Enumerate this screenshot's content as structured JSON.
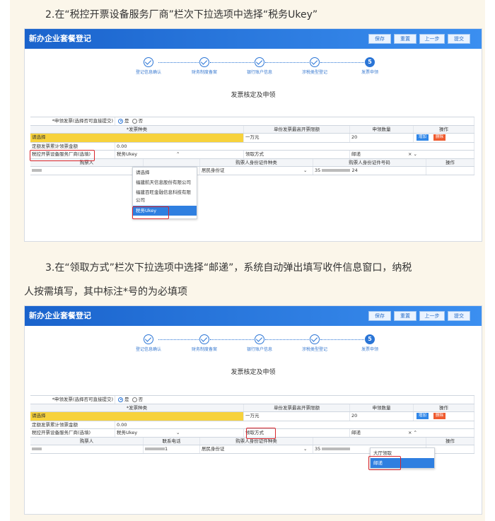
{
  "headings": {
    "step2": "2.在“税控开票设备服务厂商”栏次下拉选项中选择“税务Ukey”",
    "step3_line1": "3.在“领取方式”栏次下拉选项中选择“邮递”，系统自动弹出填写收件信息窗口，纳税",
    "step3_line2": "人按需填写，其中标注*号的为必填项"
  },
  "app": {
    "title": "新办企业套餐登记",
    "buttons": [
      "保存",
      "重置",
      "上一步",
      "提交"
    ]
  },
  "steps": [
    {
      "label": "登记信息确认",
      "state": "done"
    },
    {
      "label": "财务制度备案",
      "state": "done"
    },
    {
      "label": "银行账户信息",
      "state": "done"
    },
    {
      "label": "涉税类型登记",
      "state": "done"
    },
    {
      "label": "发票申领",
      "state": "active",
      "number": "5"
    }
  ],
  "section_title": "发票核定及申领",
  "form": {
    "apply_label": "*申领发票(选择否可直接提交)",
    "yes": "是",
    "no": "否",
    "cols": {
      "type": "*发票种类",
      "limit": "单份发票最高开票限额",
      "qty": "申领数量",
      "op": "操作"
    },
    "invoice_type": "请选择",
    "limit_value": "一万元",
    "qty_value": "20",
    "add_btn": "增加",
    "del_btn": "删除",
    "total_label": "定额发票累计领票金额",
    "total_value": "0.00",
    "vendor_label": "税控开票设备服务厂商(选填)",
    "vendor_value_a": "税务Ukey",
    "vendor_value_b": "税务Ukey",
    "pickup_label": "领取方式",
    "pickup_value": "邮递",
    "buyer_cols": {
      "buyer": "购票人",
      "phone": "联系电话",
      "id_type": "购票人身份证件种类",
      "id_no": "购票人身份证件号码",
      "op": "操作"
    },
    "id_type_value": "居民身份证",
    "id_prefix": "35",
    "id_suffix": "24",
    "phone_suffix": "1"
  },
  "dropdown_vendor": [
    "请选择",
    "福建航天信息股份有限公司",
    "福建百旺金融信息科技有限公司",
    "税务Ukey"
  ],
  "dropdown_pickup": [
    "大厅领取",
    "邮递"
  ]
}
